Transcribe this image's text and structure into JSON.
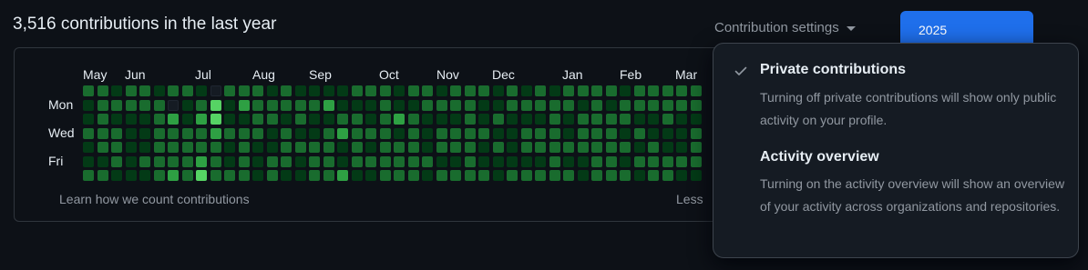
{
  "heading": "3,516 contributions in the last year",
  "settings": {
    "label": "Contribution settings",
    "caret_icon": "triangle-down-icon"
  },
  "year_button": {
    "label": "2025"
  },
  "graph": {
    "months": [
      "May",
      "Jun",
      "Jul",
      "Aug",
      "Sep",
      "Oct",
      "Nov",
      "Dec",
      "Jan",
      "Feb",
      "Mar"
    ],
    "day_labels": [
      "Mon",
      "Wed",
      "Fri"
    ],
    "learn_link": "Learn how we count contributions",
    "legend_less": "Less",
    "colors": [
      "#151b23",
      "#033a16",
      "#196c2e",
      "#2ea043",
      "#56d364"
    ],
    "levels": [
      "22122122102221211112221221222121212222122222",
      "12222201241322222311121122221122222121222222",
      "12111231341122121122123211121211121222211211",
      "22211222232221211232221212222112221222121112",
      "12211222221211222212122212221212222222212112",
      "11212222321212212212222221121111121122122222",
      "22111232422212112231122212222122222122212211"
    ]
  },
  "dropdown": {
    "items": [
      {
        "checked": true,
        "check_icon": "check-icon",
        "title": "Private contributions",
        "description": "Turning off private contributions will show only public activity on your profile."
      },
      {
        "checked": false,
        "title": "Activity overview",
        "description": "Turning on the activity overview will show an overview of your activity across organizations and repositories."
      }
    ]
  }
}
